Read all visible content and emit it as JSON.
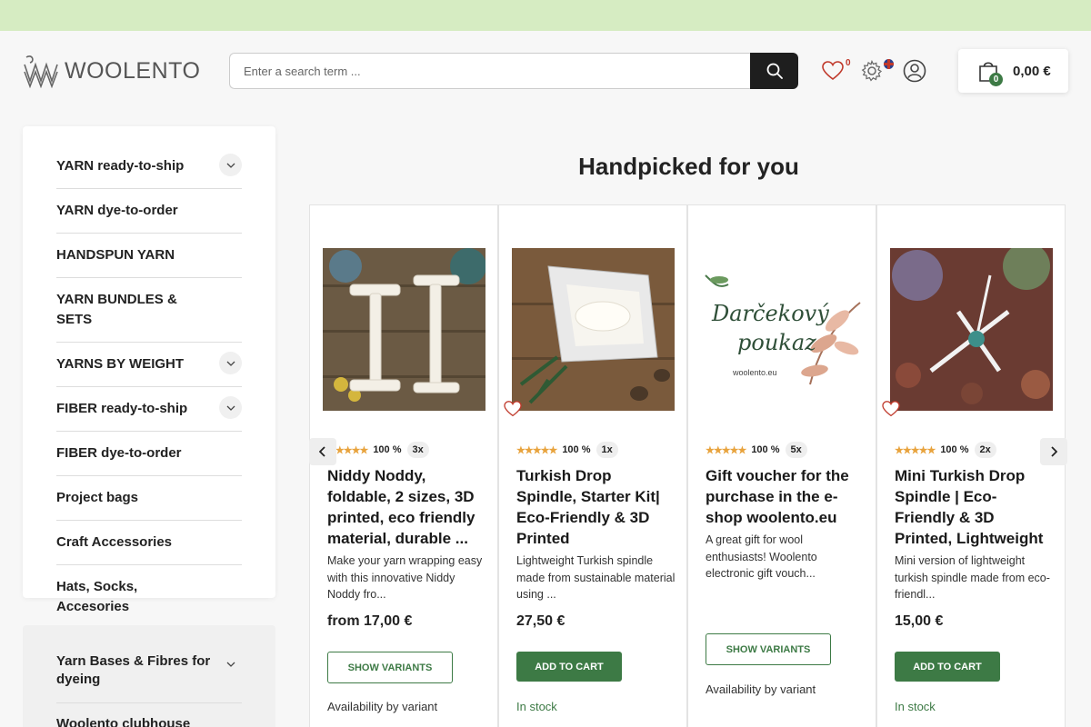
{
  "header": {
    "logo_text": "WOOLENTO",
    "search_placeholder": "Enter a search term ...",
    "wishlist_count": "0",
    "cart_count": "0",
    "cart_total": "0,00 €"
  },
  "sidebar": {
    "items": [
      {
        "label": "YARN ready-to-ship",
        "expandable": true
      },
      {
        "label": "YARN dye-to-order",
        "expandable": false
      },
      {
        "label": "HANDSPUN YARN",
        "expandable": false
      },
      {
        "label": "YARN BUNDLES & SETS",
        "expandable": false
      },
      {
        "label": "YARNS BY WEIGHT",
        "expandable": true
      },
      {
        "label": "FIBER ready-to-ship",
        "expandable": true
      },
      {
        "label": "FIBER dye-to-order",
        "expandable": false
      },
      {
        "label": "Project bags",
        "expandable": false
      },
      {
        "label": "Craft Accessories",
        "expandable": false
      },
      {
        "label": "Hats, Socks, Accesories",
        "expandable": false
      }
    ]
  },
  "sidebar2": {
    "items": [
      {
        "label": "Yarn Bases & Fibres for dyeing",
        "expandable": true
      },
      {
        "label": "Woolento clubhouse",
        "expandable": false
      }
    ]
  },
  "main": {
    "section_title": "Handpicked for you",
    "products": [
      {
        "title": "Niddy Noddy, foldable, 2 sizes, 3D printed, eco friendly material, durable ...",
        "description": "Make your yarn wrapping easy with this innovative Niddy Noddy fro...",
        "rating_percent": "100 %",
        "rating_count": "3x",
        "price": "from 17,00 €",
        "button": "SHOW VARIANTS",
        "availability": "Availability by variant",
        "image_icon": "niddy-noddy-photo"
      },
      {
        "title": "Turkish Drop Spindle, Starter Kit| Eco-Friendly & 3D Printed",
        "description": "Lightweight Turkish spindle made from sustainable material using ...",
        "rating_percent": "100 %",
        "rating_count": "1x",
        "price": "27,50 €",
        "button": "ADD TO CART",
        "availability": "In stock",
        "image_icon": "spindle-kit-photo"
      },
      {
        "title": "Gift voucher for the purchase in the e-shop woolento.eu",
        "description": "A great gift for wool enthusiasts! Woolento electronic gift vouch...",
        "rating_percent": "100 %",
        "rating_count": "5x",
        "price": "",
        "button": "SHOW VARIANTS",
        "availability": "Availability by variant",
        "image_line1": "Darčekový",
        "image_line2": "poukaz",
        "image_line3": "woolento.eu"
      },
      {
        "title": "Mini Turkish Drop Spindle | Eco-Friendly & 3D Printed, Lightweight",
        "description": "Mini version of lightweight turkish spindle made from eco-friendl...",
        "rating_percent": "100 %",
        "rating_count": "2x",
        "price": "15,00 €",
        "button": "ADD TO CART",
        "availability": "In stock",
        "image_icon": "mini-spindle-photo"
      }
    ]
  },
  "colors": {
    "banner": "#d6ecc2",
    "accent_green": "#3d7a45",
    "star": "#e8a33d"
  }
}
